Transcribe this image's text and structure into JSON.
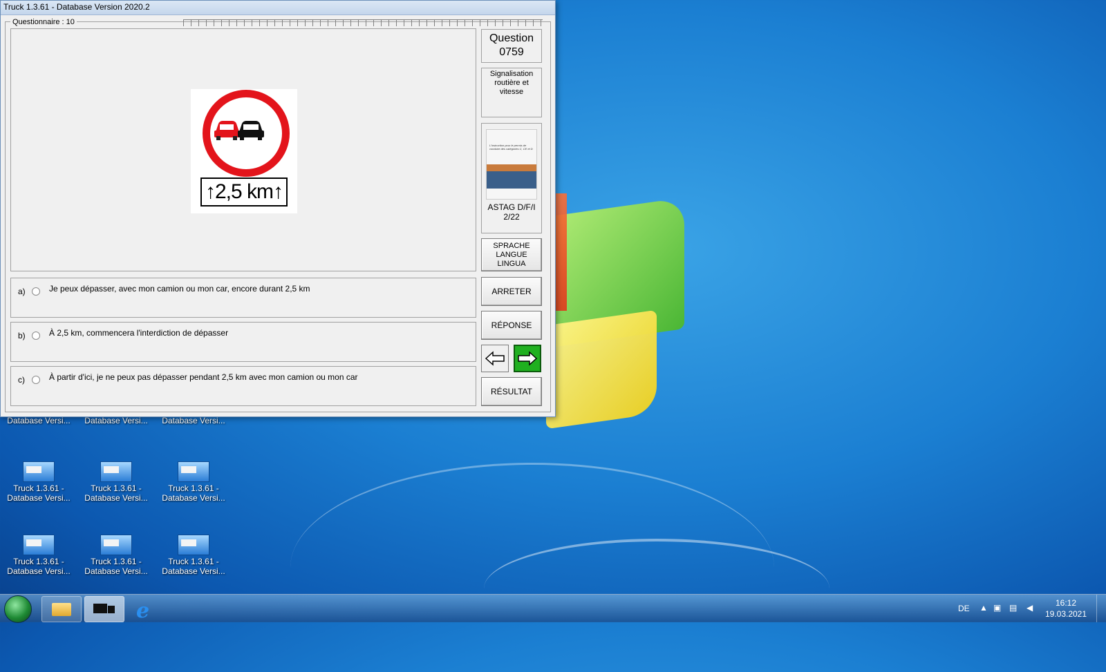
{
  "window": {
    "title": "Truck 1.3.61 - Database Version 2020.2",
    "questionnaire_label": "Questionnaire : 10"
  },
  "question": {
    "label": "Question",
    "number": "0759",
    "category": "Signalisation routière et vitesse",
    "sign_plate_text": "↑2,5 km↑",
    "source_cover_text": "L'instruction pour le permis de conduire des catégories C, CE et D",
    "source_line1": "ASTAG D/F/I",
    "source_line2": "2/22"
  },
  "answers": [
    {
      "letter": "a)",
      "text": "Je peux dépasser, avec mon camion ou mon car, encore durant 2,5 km"
    },
    {
      "letter": "b)",
      "text": "À 2,5 km, commencera l'interdiction de dépasser"
    },
    {
      "letter": "c)",
      "text": "À partir d'ici, je ne peux pas dépasser pendant  2,5 km avec mon camion ou mon car"
    }
  ],
  "buttons": {
    "language_line1": "SPRACHE",
    "language_line2": "LANGUE",
    "language_line3": "LINGUA",
    "stop": "ARRETER",
    "answer": "RÉPONSE",
    "result": "RÉSULTAT"
  },
  "desktop_icons": [
    {
      "line1": "",
      "line2": "Database Versi..."
    },
    {
      "line1": "",
      "line2": "Database Versi..."
    },
    {
      "line1": "",
      "line2": "Database Versi..."
    },
    {
      "line1": "Truck 1.3.61 -",
      "line2": "Database Versi..."
    },
    {
      "line1": "Truck 1.3.61 -",
      "line2": "Database Versi..."
    },
    {
      "line1": "Truck 1.3.61 -",
      "line2": "Database Versi..."
    },
    {
      "line1": "Truck 1.3.61 -",
      "line2": "Database Versi..."
    },
    {
      "line1": "Truck 1.3.61 -",
      "line2": "Database Versi..."
    },
    {
      "line1": "Truck 1.3.61 -",
      "line2": "Database Versi..."
    }
  ],
  "taskbar": {
    "language": "DE",
    "time": "16:12",
    "date": "19.03.2021",
    "icons": [
      "start-orb-icon",
      "folder-icon",
      "truck-app-icon",
      "internet-explorer-icon"
    ]
  },
  "colors": {
    "sign_red": "#e3141b",
    "next_button_green": "#20b020",
    "desktop_blue": "#1b7fd2"
  }
}
